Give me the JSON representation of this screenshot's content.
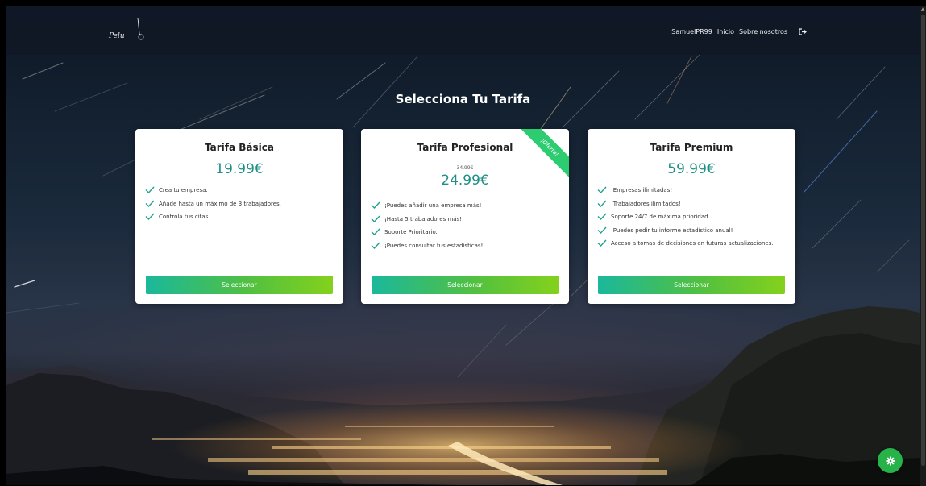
{
  "brand": {
    "logo_text": "Pelu"
  },
  "nav": {
    "user": "SamuelPR99",
    "home": "Inicio",
    "about": "Sobre nosotros",
    "logout_icon": "logout-icon"
  },
  "page": {
    "title": "Selecciona Tu Tarifa"
  },
  "plans": [
    {
      "title": "Tarifa Básica",
      "price": "19.99€",
      "features": [
        "Crea tu empresa.",
        "Añade hasta un máximo de 3 trabajadores.",
        "Controla tus citas."
      ],
      "button": "Seleccionar"
    },
    {
      "title": "Tarifa Profesional",
      "old_price": "34.99€",
      "price": "24.99€",
      "ribbon": "¡Oferta!",
      "features": [
        "¡Puedes añadir una empresa más!",
        "¡Hasta 5 trabajadores más!",
        "Soporte Prioritario.",
        "¡Puedes consultar tus estadísticas!"
      ],
      "button": "Seleccionar"
    },
    {
      "title": "Tarifa Premium",
      "price": "59.99€",
      "features": [
        "¡Empresas ilimitadas!",
        "¡Trabajadores ilimitados!",
        "Soporte 24/7 de máxima prioridad.",
        "¡Puedes pedir tu informe estadístico anual!",
        "Acceso a tomas de decisiones en futuras actualizaciones."
      ],
      "button": "Seleccionar"
    }
  ],
  "colors": {
    "accent_price": "#1f8f86",
    "button_gradient_start": "#1ab89c",
    "button_gradient_end": "#84d11c",
    "ribbon": "#2ecc71",
    "fab": "#27b24a"
  },
  "fab": {
    "icon": "gear-icon"
  }
}
